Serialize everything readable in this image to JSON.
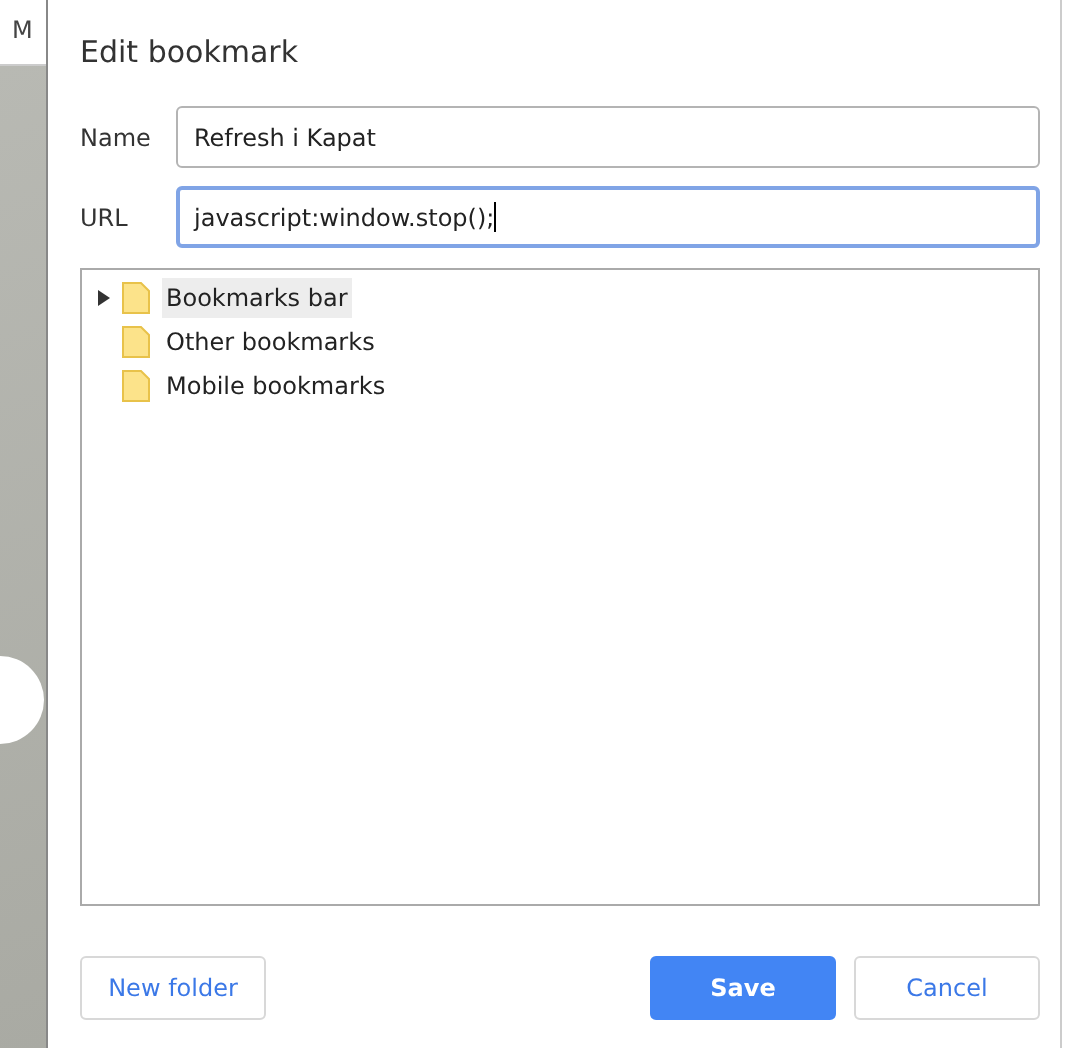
{
  "backdrop": {
    "tab_text": "M"
  },
  "dialog": {
    "title": "Edit bookmark",
    "fields": [
      {
        "label": "Name",
        "value": "Refresh i Kapat",
        "focused": false
      },
      {
        "label": "URL",
        "value": "javascript:window.stop();",
        "focused": true
      }
    ],
    "tree": {
      "items": [
        {
          "label": "Bookmarks bar",
          "expandable": true,
          "selected": true
        },
        {
          "label": "Other bookmarks",
          "expandable": false,
          "selected": false
        },
        {
          "label": "Mobile bookmarks",
          "expandable": false,
          "selected": false
        }
      ]
    },
    "buttons": [
      {
        "label": "New folder",
        "kind": "secondary"
      },
      {
        "label": "Save",
        "kind": "primary"
      },
      {
        "label": "Cancel",
        "kind": "secondary"
      }
    ]
  }
}
